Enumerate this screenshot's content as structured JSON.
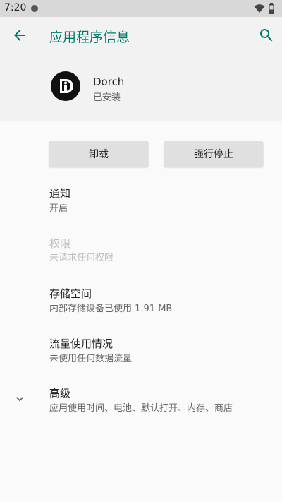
{
  "status": {
    "time": "7:20"
  },
  "appbar": {
    "title": "应用程序信息",
    "back_icon": "arrow-left-icon",
    "search_icon": "search-icon",
    "accent": "#00796b"
  },
  "app": {
    "name": "Dorch",
    "status": "已安装",
    "logo_icon": "dorch-logo-icon"
  },
  "actions": {
    "uninstall": "卸载",
    "force_stop": "强行停止"
  },
  "items": [
    {
      "title": "通知",
      "subtitle": "开启",
      "enabled": true
    },
    {
      "title": "权限",
      "subtitle": "未请求任何权限",
      "enabled": false
    },
    {
      "title": "存储空间",
      "subtitle": "内部存储设备已使用 1.91 MB",
      "enabled": true
    },
    {
      "title": "流量使用情况",
      "subtitle": "未使用任何数据流量",
      "enabled": true
    },
    {
      "title": "高级",
      "subtitle": "应用使用时间、电池、默认打开、内存、商店",
      "enabled": true
    }
  ]
}
